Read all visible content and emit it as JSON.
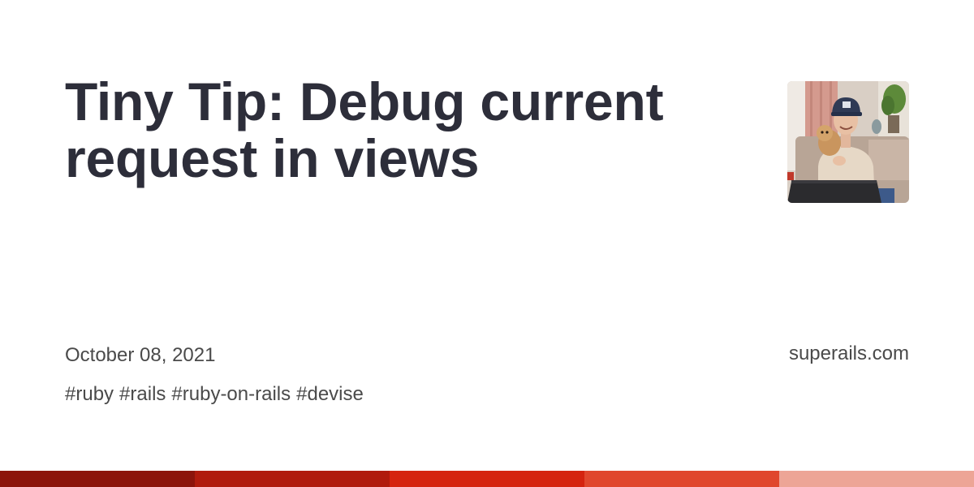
{
  "post": {
    "title": "Tiny Tip: Debug current request in views",
    "date": "October 08, 2021",
    "tags": [
      "#ruby",
      "#rails",
      "#ruby-on-rails",
      "#devise"
    ],
    "site": "superails.com"
  },
  "colors": {
    "title_text": "#2d2e3a",
    "meta_text": "#4a4a4a",
    "stripe": [
      "#8c140b",
      "#b01b0d",
      "#d5240f",
      "#e0472d",
      "#eda596"
    ]
  }
}
